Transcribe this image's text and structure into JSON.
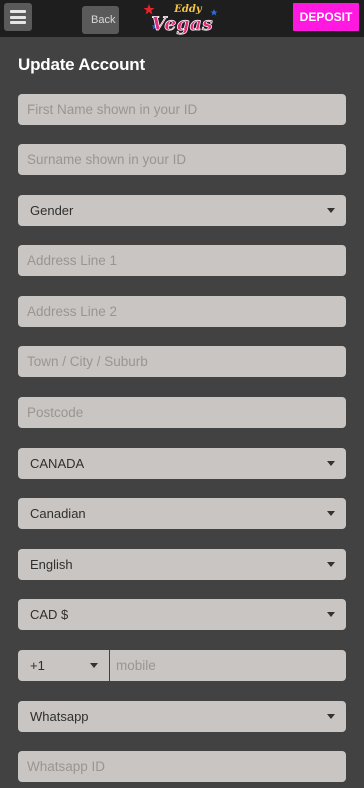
{
  "header": {
    "back_label": "Back",
    "deposit_label": "DEPOSIT",
    "logo_text_top": "Eddy",
    "logo_text_main": "Vegas",
    "accent_color": "#ff18e0"
  },
  "form": {
    "title": "Update Account",
    "first_name_placeholder": "First Name shown in your ID",
    "surname_placeholder": "Surname shown in your ID",
    "gender_value": "Gender",
    "address1_placeholder": "Address Line 1",
    "address2_placeholder": "Address Line 2",
    "town_placeholder": "Town / City / Suburb",
    "postcode_placeholder": "Postcode",
    "country_value": "CANADA",
    "nationality_value": "Canadian",
    "language_value": "English",
    "currency_value": "CAD $",
    "phone_code_value": "+1",
    "mobile_placeholder": "mobile",
    "messenger_value": "Whatsapp",
    "messenger_id_placeholder": "Whatsapp ID"
  },
  "icons": {
    "menu": "hamburger-icon",
    "back": "back-arrow-icon",
    "dropdown": "chevron-down-icon"
  }
}
